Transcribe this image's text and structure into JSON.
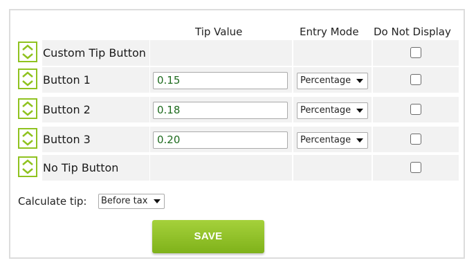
{
  "headers": {
    "tip_value": "Tip Value",
    "entry_mode": "Entry Mode",
    "do_not_display": "Do Not Display"
  },
  "rows": [
    {
      "label": "Custom Tip Button",
      "tip_value": null,
      "entry_mode": null,
      "do_not_display": false
    },
    {
      "label": "Button 1",
      "tip_value": "0.15",
      "entry_mode": "Percentage",
      "do_not_display": false
    },
    {
      "label": "Button 2",
      "tip_value": "0.18",
      "entry_mode": "Percentage",
      "do_not_display": false
    },
    {
      "label": "Button 3",
      "tip_value": "0.20",
      "entry_mode": "Percentage",
      "do_not_display": false
    },
    {
      "label": "No Tip Button",
      "tip_value": null,
      "entry_mode": null,
      "do_not_display": false
    }
  ],
  "calculate": {
    "label": "Calculate tip:",
    "value": "Before tax"
  },
  "save_label": "SAVE",
  "colors": {
    "accent": "#8fc21f",
    "input_text": "#1e6b1e",
    "row_bg": "#f2f2f2"
  },
  "icons": {
    "drag_handle": "up-down-chevrons-icon",
    "select_caret": "caret-down-icon"
  }
}
